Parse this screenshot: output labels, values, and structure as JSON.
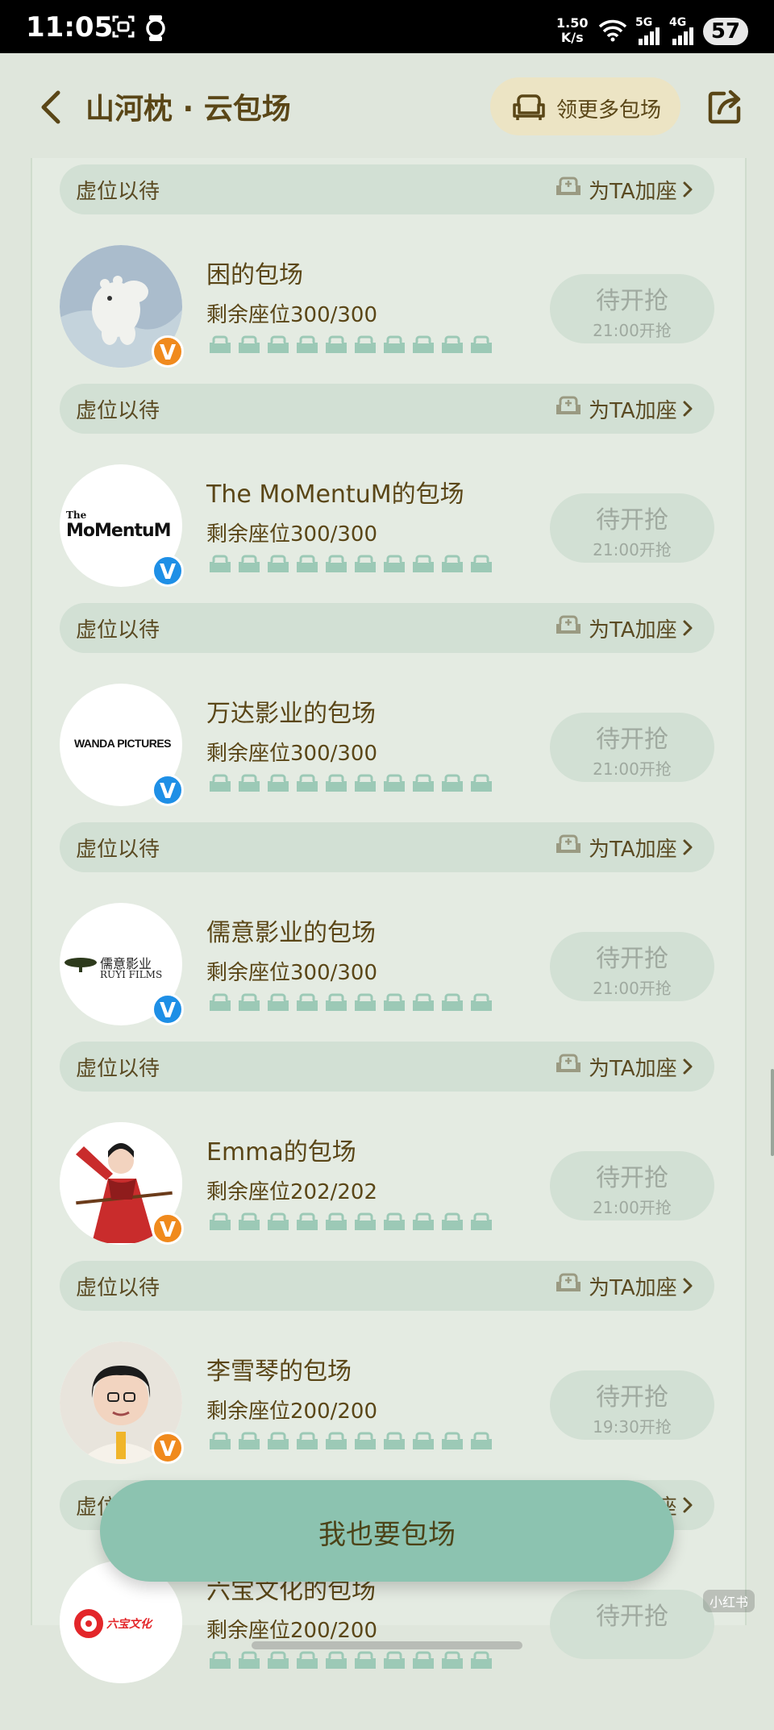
{
  "status_bar": {
    "time": "11:05",
    "speed_value": "1.50",
    "speed_unit": "K/s",
    "net1": "5G",
    "net2": "4G",
    "battery": "57"
  },
  "header": {
    "title": "山河枕 · 云包场",
    "more_button": "领更多包场",
    "icons": [
      "back-arrow-icon",
      "sofa-icon",
      "share-icon"
    ]
  },
  "common": {
    "vacant_label": "虚位以待",
    "add_seat_label": "为TA加座"
  },
  "items": [
    {
      "name": "困的包场",
      "seats": "剩余座位300/300",
      "status": "待开抢",
      "time": "21:00开抢",
      "badge": "orange",
      "avatar": "moomin"
    },
    {
      "name": "The MoMentuM的包场",
      "seats": "剩余座位300/300",
      "status": "待开抢",
      "time": "21:00开抢",
      "badge": "blue",
      "avatar": "momentum",
      "logo_lines": [
        "The",
        "MoMentuM"
      ]
    },
    {
      "name": "万达影业的包场",
      "seats": "剩余座位300/300",
      "status": "待开抢",
      "time": "21:00开抢",
      "badge": "blue",
      "avatar": "wanda",
      "logo_text": "WANDA PICTURES"
    },
    {
      "name": "儒意影业的包场",
      "seats": "剩余座位300/300",
      "status": "待开抢",
      "time": "21:00开抢",
      "badge": "blue",
      "avatar": "ruyi",
      "logo_lines": [
        "儒意影业",
        "RUYI FILMS"
      ]
    },
    {
      "name": "Emma的包场",
      "seats": "剩余座位202/202",
      "status": "待开抢",
      "time": "21:00开抢",
      "badge": "orange",
      "avatar": "emma"
    },
    {
      "name": "李雪琴的包场",
      "seats": "剩余座位200/200",
      "status": "待开抢",
      "time": "19:30开抢",
      "badge": "orange",
      "avatar": "lixueqin"
    },
    {
      "name": "六宝文化的包场",
      "seats": "剩余座位200/200",
      "status": "待开抢",
      "time": "",
      "badge": "",
      "avatar": "liubao",
      "logo_text": "六宝文化"
    }
  ],
  "cta": {
    "label": "我也要包场"
  },
  "watermark": "小红书",
  "colors": {
    "background": "#dfe6dc",
    "accent_green": "#8cc3b0",
    "text_brown": "#5a4617",
    "seat_green": "#9cc9b6",
    "badge_orange": "#f08a1d",
    "badge_blue": "#1e8fe6"
  }
}
